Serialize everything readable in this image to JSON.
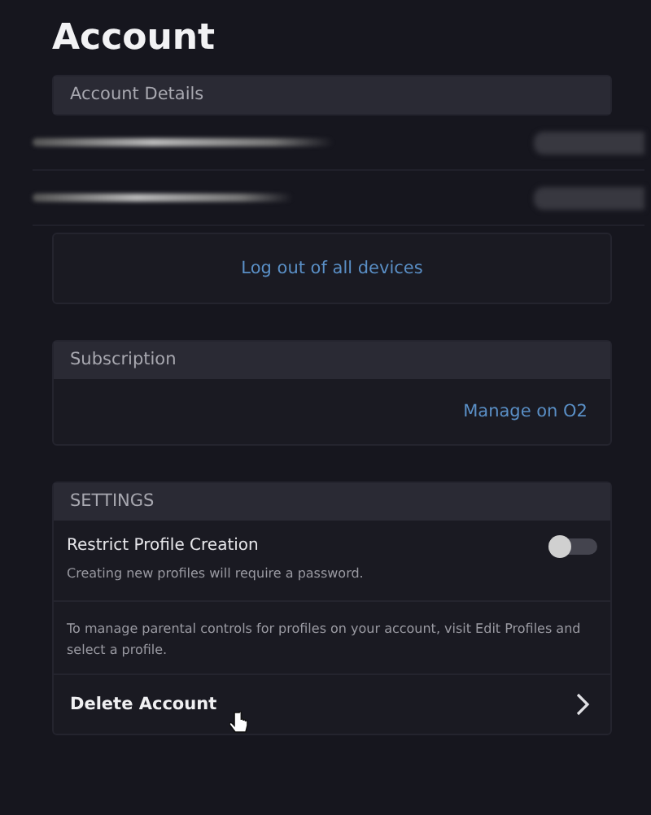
{
  "title": "Account",
  "account_details": {
    "header": "Account Details",
    "logout_link": "Log out of all devices"
  },
  "subscription": {
    "header": "Subscription",
    "manage_link": "Manage on O2"
  },
  "settings": {
    "header": "SETTINGS",
    "restrict_profile": {
      "label": "Restrict Profile Creation",
      "description": "Creating new profiles will require a password.",
      "on": false
    },
    "parental_note": "To manage parental controls for profiles on your account, visit Edit Profiles and select a profile.",
    "delete_account": "Delete Account"
  }
}
